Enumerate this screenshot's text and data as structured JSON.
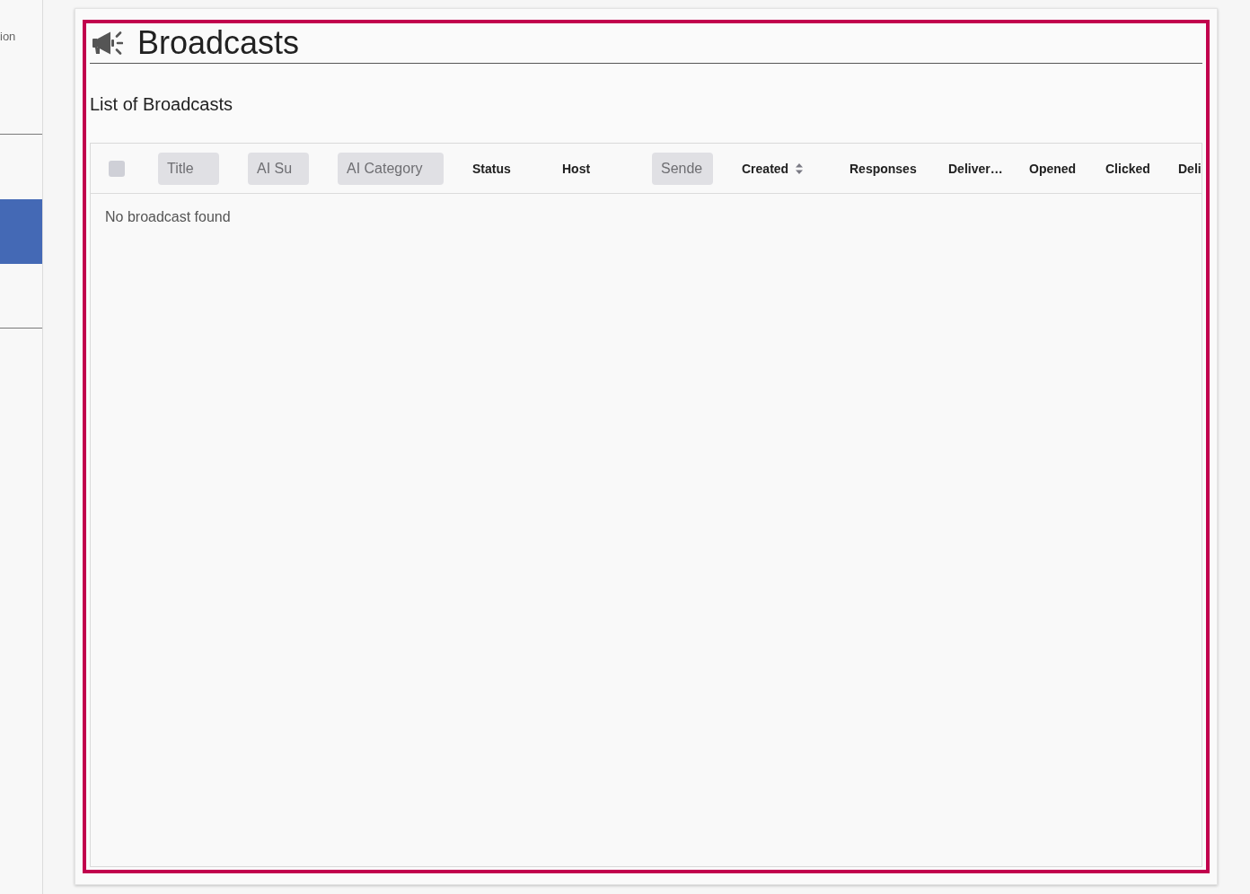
{
  "sidebar": {
    "items": [
      {
        "label": "ion",
        "selected": false
      },
      {
        "selected": true
      }
    ]
  },
  "page": {
    "title": "Broadcasts",
    "subtitle": "List of Broadcasts"
  },
  "table": {
    "select_all": {
      "checked": false
    },
    "columns": [
      {
        "kind": "filter",
        "placeholder": "Title"
      },
      {
        "kind": "filter",
        "placeholder": "AI Su"
      },
      {
        "kind": "filter",
        "placeholder": "AI Category"
      },
      {
        "kind": "plain",
        "label": "Status"
      },
      {
        "kind": "plain",
        "label": "Host"
      },
      {
        "kind": "filter",
        "placeholder": "Sende"
      },
      {
        "kind": "sortable",
        "label": "Created"
      },
      {
        "kind": "plain",
        "label": "Responses"
      },
      {
        "kind": "plain",
        "label": "Deliver…"
      },
      {
        "kind": "plain",
        "label": "Opened"
      },
      {
        "kind": "plain",
        "label": "Clicked"
      },
      {
        "kind": "plain",
        "label": "Deli"
      }
    ],
    "empty_message": "No broadcast found"
  }
}
